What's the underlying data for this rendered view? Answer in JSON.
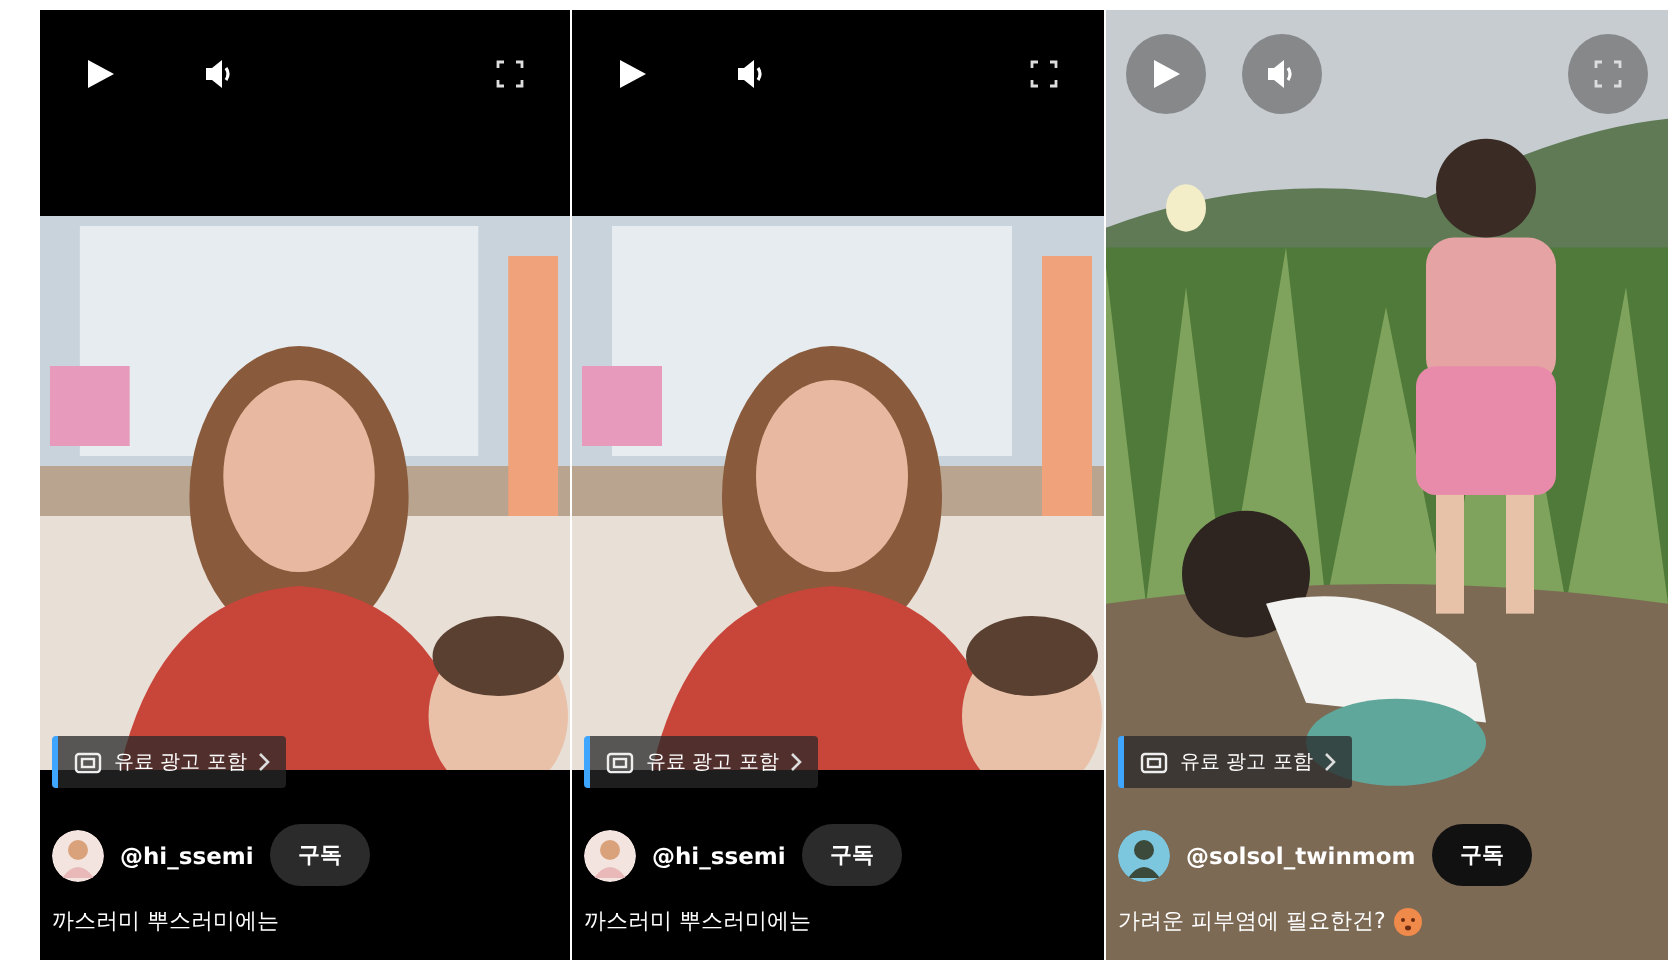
{
  "shorts": [
    {
      "kind": "letterbox",
      "ad_badge": "유료 광고 포함",
      "channel": "@hi_ssemi",
      "subscribe": "구독",
      "description": "까스러미 뿌스러미에는",
      "emoji": false
    },
    {
      "kind": "letterbox",
      "ad_badge": "유료 광고 포함",
      "channel": "@hi_ssemi",
      "subscribe": "구독",
      "description": "까스러미 뿌스러미에는",
      "emoji": false
    },
    {
      "kind": "fullbleed",
      "ad_badge": "유료 광고 포함",
      "channel": "@solsol_twinmom",
      "subscribe": "구독",
      "description": "가려운 피부염에 필요한건?",
      "emoji": true
    }
  ]
}
